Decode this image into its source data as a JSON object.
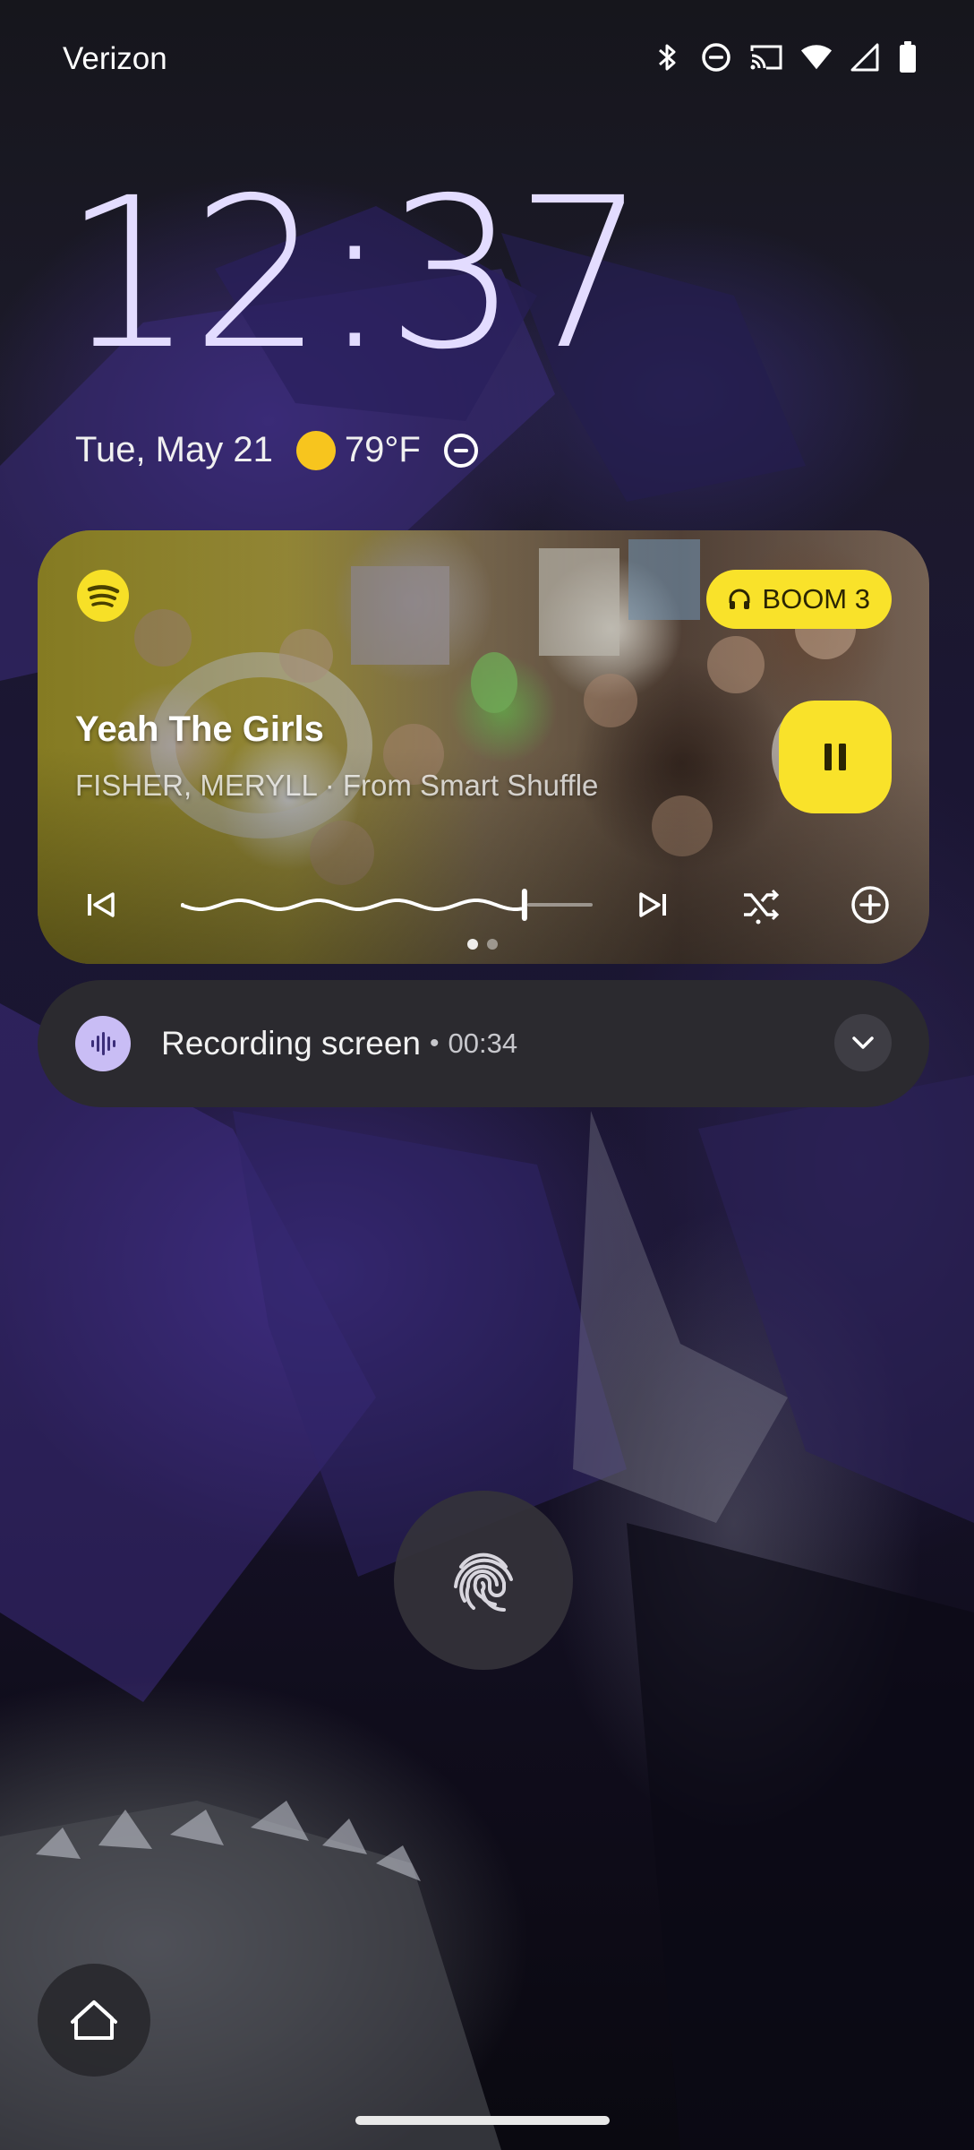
{
  "status_bar": {
    "carrier": "Verizon",
    "icons": [
      "bluetooth-icon",
      "do-not-disturb-icon",
      "cast-icon",
      "wifi-icon",
      "cellular-signal-icon",
      "battery-icon"
    ]
  },
  "lockscreen": {
    "time": "12:37",
    "date": "Tue, May 21",
    "weather": {
      "icon": "sun-icon",
      "temperature": "79°F",
      "color": "#f7c51e"
    },
    "dnd_icon": "do-not-disturb-icon",
    "clock_color": "#e3dcff"
  },
  "media": {
    "app_icon": "spotify-icon",
    "output_device": "BOOM 3",
    "output_icon": "headphones-icon",
    "title": "Yeah The Girls",
    "artist_line": "FISHER, MERYLL · From Smart Shuffle",
    "accent_color": "#f9e22a",
    "state": "playing",
    "progress": 0.92,
    "page_count": 2,
    "active_page": 1
  },
  "notification": {
    "icon": "sound-wave-icon",
    "title": "Recording screen",
    "separator": "•",
    "elapsed": "00:34"
  },
  "fingerprint_icon": "fingerprint-icon",
  "home_shortcut_icon": "home-icon"
}
